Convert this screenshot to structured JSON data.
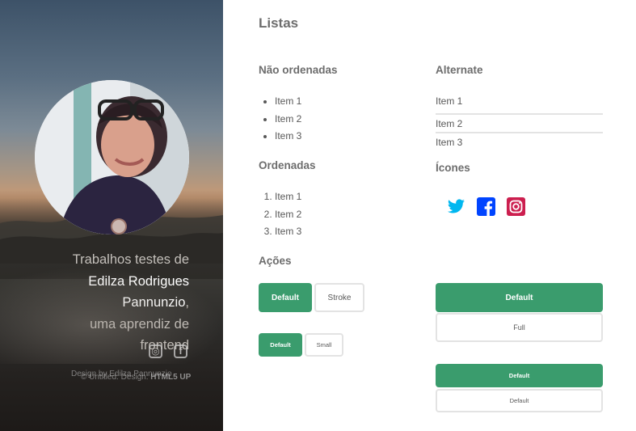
{
  "sidebar": {
    "intro_lead": "Trabalhos testes de",
    "name_line1": "Edilza Rodrigues",
    "name_line2": "Pannunzio",
    "name_comma": ",",
    "intro_tail1": "uma aprendiz de",
    "intro_tail2": "frontend",
    "social_icons": [
      "instagram-icon",
      "facebook-icon"
    ],
    "credits_design": "Design by Edilza Pannunzio",
    "credits_untitled": "© Untitled. Design:",
    "credits_html5up": "HTML5 UP"
  },
  "main": {
    "title": "Listas",
    "unordered_title": "Não ordenadas",
    "unordered_items": [
      "Item 1",
      "Item 2",
      "Item 3"
    ],
    "ordered_title": "Ordenadas",
    "ordered_items": [
      "Item 1",
      "Item 2",
      "Item 3"
    ],
    "alternate_title": "Alternate",
    "alternate_items": [
      "Item 1",
      "Item 2",
      "Item 3"
    ],
    "icons_title": "Ícones",
    "icons": [
      {
        "name": "twitter-icon",
        "color": "#00b7f0"
      },
      {
        "name": "facebook-icon",
        "color": "#0044ff"
      },
      {
        "name": "instagram-icon",
        "color": "#cc1f4f"
      }
    ],
    "actions_title": "Ações",
    "buttons": {
      "default_label": "Default",
      "stroke_label": "Stroke",
      "small_default_label": "Default",
      "small_label": "Small",
      "fit_default_label": "Default",
      "full_label": "Full",
      "fit_small_default_label": "Default",
      "fit_small_label": "Default"
    }
  },
  "colors": {
    "accent": "#3a9c6d",
    "border": "#e3e3e3",
    "text": "#585858"
  }
}
